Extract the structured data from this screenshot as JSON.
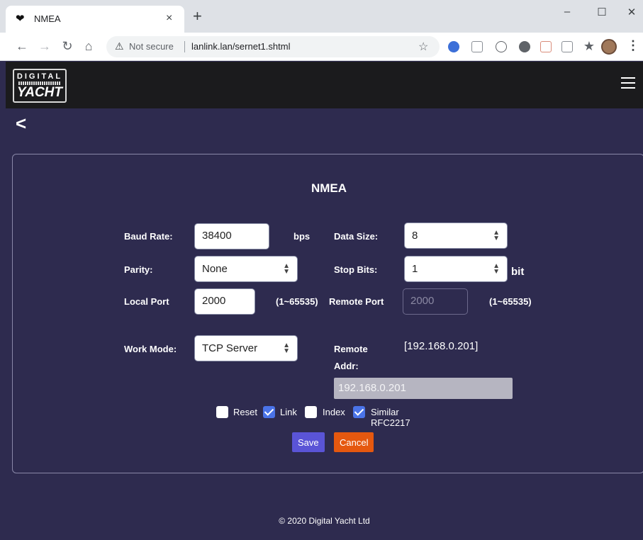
{
  "browser": {
    "tab_title": "NMEA",
    "tab_close": "×",
    "new_tab": "+",
    "minimize": "–",
    "maximize": "☐",
    "close": "✕",
    "not_secure": "Not secure",
    "url": "lanlink.lan/sernet1.shtml",
    "icons": [
      "back-arrow",
      "forward-arrow",
      "reload",
      "home",
      "warning",
      "star",
      "extensions",
      "profile",
      "menu"
    ]
  },
  "header": {
    "logo_top": "DIGITAL",
    "logo_main": "YACHT"
  },
  "back_label": "<",
  "form": {
    "title": "NMEA",
    "baud_rate_label": "Baud Rate:",
    "baud_rate_value": "38400",
    "baud_rate_unit": "bps",
    "data_size_label": "Data Size:",
    "data_size_value": "8",
    "parity_label": "Parity:",
    "parity_value": "None",
    "stop_bits_label": "Stop Bits:",
    "stop_bits_value": "1",
    "stop_bits_unit": "bit",
    "local_port_label": "Local Port",
    "local_port_value": "2000",
    "local_port_range": "(1~65535)",
    "remote_port_label": "Remote Port",
    "remote_port_value": "2000",
    "remote_port_range": "(1~65535)",
    "work_mode_label": "Work Mode:",
    "work_mode_value": "TCP Server",
    "remote_addr_label_1": "Remote",
    "remote_addr_label_2": "Addr:",
    "remote_addr_display": "[192.168.0.201]",
    "remote_addr_value": "192.168.0.201",
    "reset_label": "Reset",
    "reset_checked": false,
    "link_label": "Link",
    "link_checked": true,
    "index_label": "Index",
    "index_checked": false,
    "rfc_label": "Similar RFC2217",
    "rfc_checked": true,
    "save_label": "Save",
    "cancel_label": "Cancel"
  },
  "footer": "© 2020 Digital Yacht Ltd",
  "colors": {
    "page_bg": "#2e2b4f",
    "header_bg": "#1b1b1d",
    "save_btn": "#5a54d6",
    "cancel_btn": "#e5580f",
    "checkbox_checked": "#4a73e8"
  }
}
